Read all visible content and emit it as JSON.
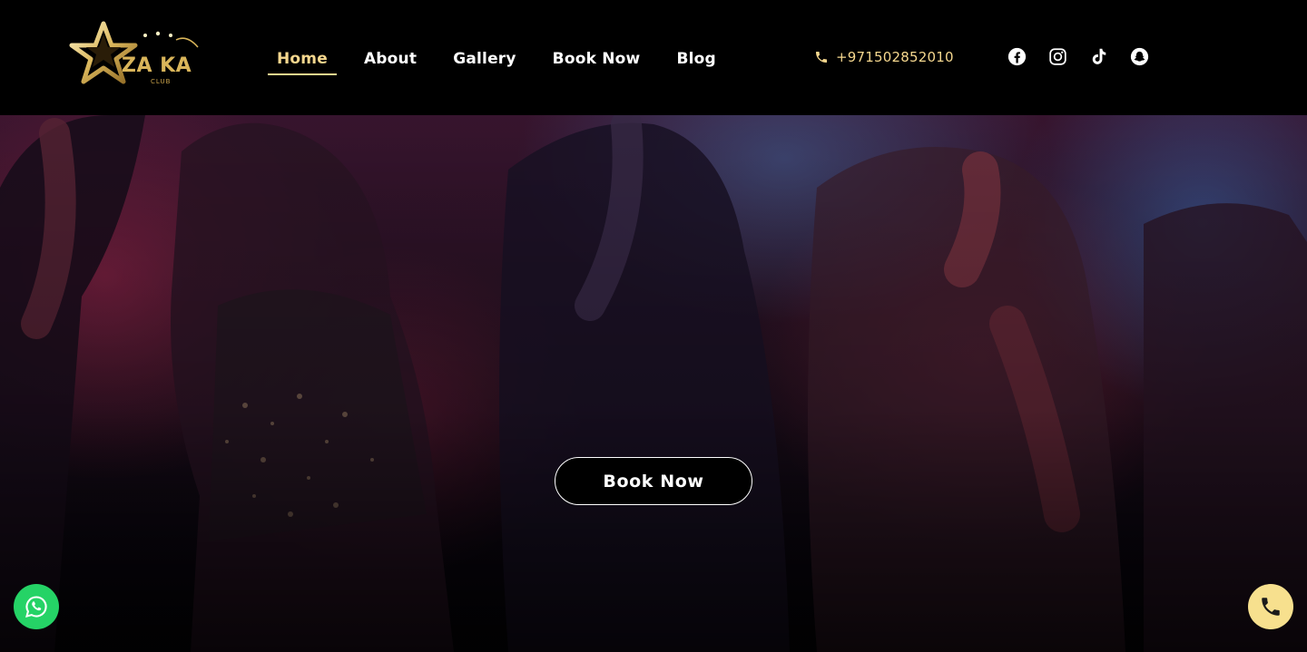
{
  "brand": {
    "logo_text": "ZA KA",
    "logo_sub": "CLUB",
    "gold": "#d9b55a",
    "accent": "#f5d78e"
  },
  "nav": {
    "items": [
      {
        "label": "Home",
        "active": true
      },
      {
        "label": "About",
        "active": false
      },
      {
        "label": "Gallery",
        "active": false
      },
      {
        "label": "Book Now",
        "active": false
      },
      {
        "label": "Blog",
        "active": false
      }
    ]
  },
  "contact": {
    "phone": "+971502852010",
    "phone_icon": "phone-icon"
  },
  "socials": [
    {
      "icon": "facebook-icon"
    },
    {
      "icon": "instagram-icon"
    },
    {
      "icon": "tiktok-icon"
    },
    {
      "icon": "snapchat-icon"
    }
  ],
  "hero": {
    "button_label": "Book Now"
  },
  "floating": {
    "whatsapp_icon": "whatsapp-icon",
    "whatsapp_color": "#25d366",
    "call_icon": "phone-icon",
    "call_color": "#f7e08e"
  }
}
